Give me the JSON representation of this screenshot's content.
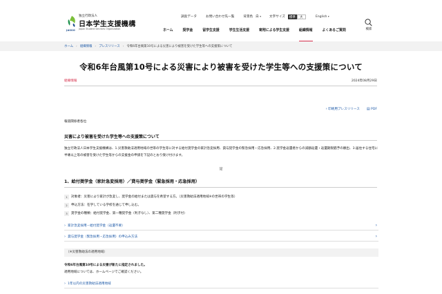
{
  "header": {
    "logo_sub": "独立行政法人",
    "logo_main": "日本学生支援機構",
    "logo_en": "Japan Student Services Organization",
    "logo_jasso": "JASSO",
    "util": {
      "survey": "調査データ",
      "contact": "お問い合わせ先一覧",
      "color_label": "背景色",
      "color_value": "白",
      "size_label": "文字サイズ",
      "size_std": "標準",
      "size_large": "大",
      "lang": "English"
    },
    "nav": [
      "ホーム",
      "奨学金",
      "留学生支援",
      "学生生活支援",
      "寄附による学生支援",
      "組織情報",
      "よくあるご質問"
    ],
    "search_label": "検索"
  },
  "breadcrumb": [
    "ホーム",
    "組織情報",
    "プレスリリース",
    "令和6年台風第10号による災害により被害を受けた学生等への支援策について"
  ],
  "title": "令和6年台風第10号による災害により被害を受けた学生等への支援策について",
  "category": "組織情報",
  "date": "2024年08月29日",
  "print_links": {
    "print": "印刷用プレスリリース",
    "pdf": "PDF"
  },
  "addressee": "報道関係者各位",
  "subtitle": "災害により被害を受けた学生等への支援策について",
  "body": "独立行政法人日本学生支援機構は、1.災害救助法適用地域の世帯の学生等に対する給付奨学金の家計急変採用、貸与奨学金の緊急採用・応急採用、2.奨学金返還者からの減額返還・返還期限猶予の願出、3.居住する住宅に半壊以上等の被害を受けた学生等からの支援金の申請を下記のとおり受け付けます。",
  "ki": "記",
  "section1": {
    "title": "1、給付奨学金（家計急変採用）／貸与奨学金（緊急採用・応急採用）",
    "items": [
      "対象者：災害により家計が急変し、奨学金の給付または貸与を希望する方。（災害救助法適用地域※の世帯の学生等）",
      "申込方法：在学している学校を通じて申し込む。",
      "奨学金の種類：給付奨学金、第一種奨学金（利子なし）、第二種奨学金（利子付）"
    ],
    "links": [
      "家計急変採用－給付奨学金（返還不要）",
      "貸与奨学金（緊急採用・応急採用）の申込み方法"
    ]
  },
  "note": {
    "label": "（※災害救助法の適用地域）",
    "line1": "令和6年台風第10号による災害が新たに指定されました。",
    "line2": "適用地域については、ホームページでご確認ください。",
    "link": "1年以内の災害救助法適用地域"
  }
}
